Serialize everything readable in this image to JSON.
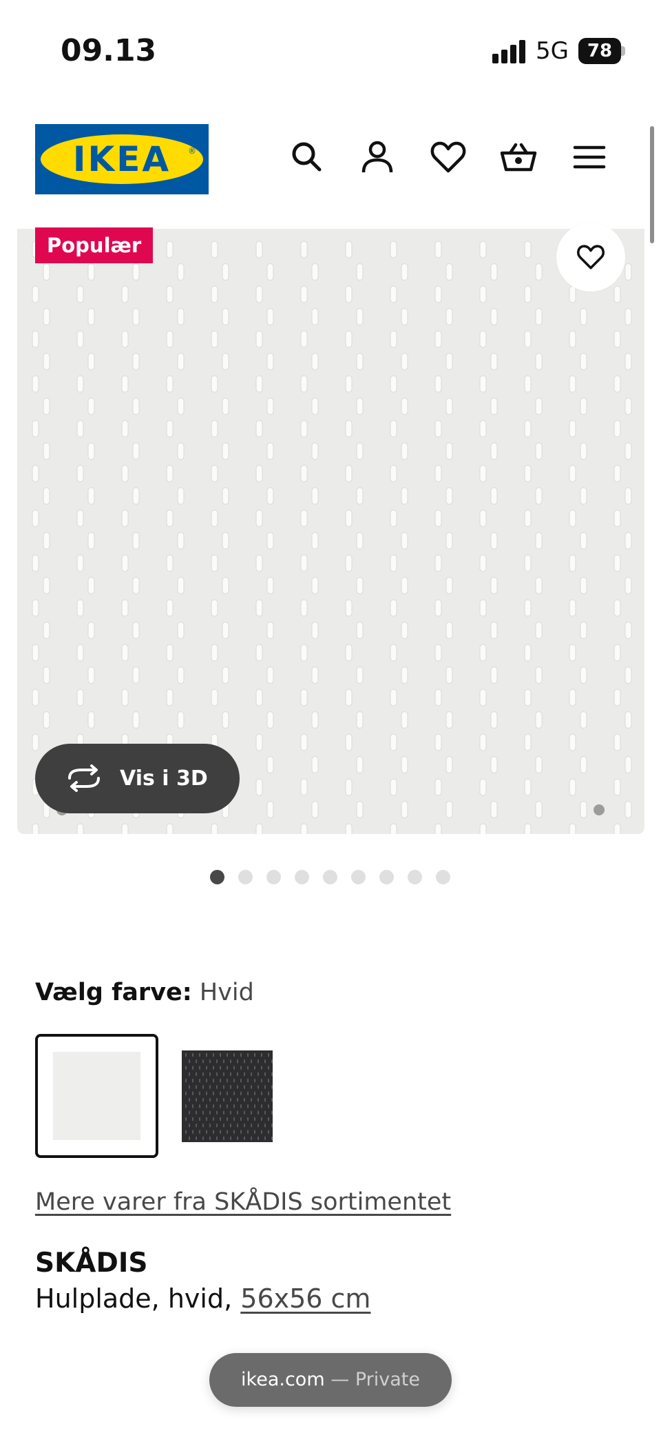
{
  "status_bar": {
    "time": "09.13",
    "network": "5G",
    "battery": "78"
  },
  "header": {
    "logo_text": "IKEA",
    "icons": [
      "search-icon",
      "account-icon",
      "heart-icon",
      "basket-icon",
      "menu-icon"
    ]
  },
  "hero": {
    "badge": "Populær",
    "view_3d_label": "Vis i 3D",
    "image_count": 9,
    "active_image": 1
  },
  "color_choice": {
    "label": "Vælg farve:",
    "selected": "Hvid",
    "options": [
      "Hvid",
      "Sort"
    ]
  },
  "series_link": "Mere varer fra SKÅDIS sortimentet",
  "product": {
    "name": "SKÅDIS",
    "description": "Hulplade, hvid,",
    "size": "56x56 cm"
  },
  "browser": {
    "domain": "ikea.com",
    "mode": "— Private"
  },
  "colors": {
    "brand_blue": "#0058a3",
    "brand_yellow": "#ffdb00",
    "badge_red": "#e00751"
  }
}
